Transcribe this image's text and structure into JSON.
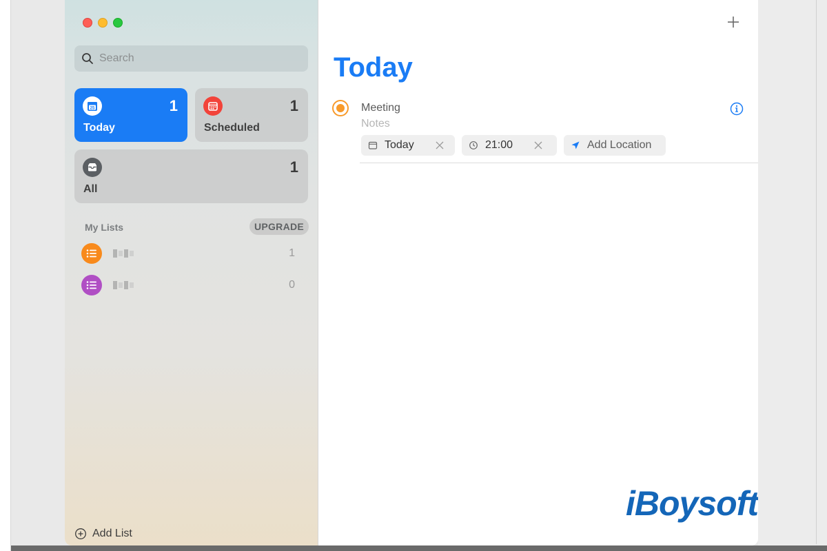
{
  "window": {
    "controls": [
      "close",
      "minimize",
      "zoom"
    ]
  },
  "sidebar": {
    "search": {
      "placeholder": "Search",
      "value": ""
    },
    "smart_lists": [
      {
        "label": "Today",
        "count": "1",
        "icon": "calendar-icon",
        "color": "#1a7cf5",
        "day": "25"
      },
      {
        "label": "Scheduled",
        "count": "1",
        "icon": "calendar-grid-icon",
        "color": "#f2433a"
      },
      {
        "label": "All",
        "count": "1",
        "icon": "tray-icon",
        "color": "#5b5f63"
      }
    ],
    "my_lists_header": "My Lists",
    "upgrade_label": "UPGRADE",
    "lists": [
      {
        "name_blurred": true,
        "count": "1",
        "icon": "list-icon",
        "color": "#f88a1c"
      },
      {
        "name_blurred": true,
        "count": "0",
        "icon": "list-icon",
        "color": "#b04fc4"
      }
    ],
    "add_list_label": "Add List"
  },
  "main": {
    "title": "Today",
    "add_icon": "plus-icon",
    "reminders": [
      {
        "title": "Meeting",
        "notes_placeholder": "Notes",
        "date_chip": "Today",
        "time_chip": "21:00",
        "location_chip": "Add Location",
        "flag_color": "#f89a2a"
      }
    ]
  },
  "watermark": "iBoysoft",
  "colors": {
    "accent": "#1a7cf5",
    "watermark": "#1466b8"
  }
}
